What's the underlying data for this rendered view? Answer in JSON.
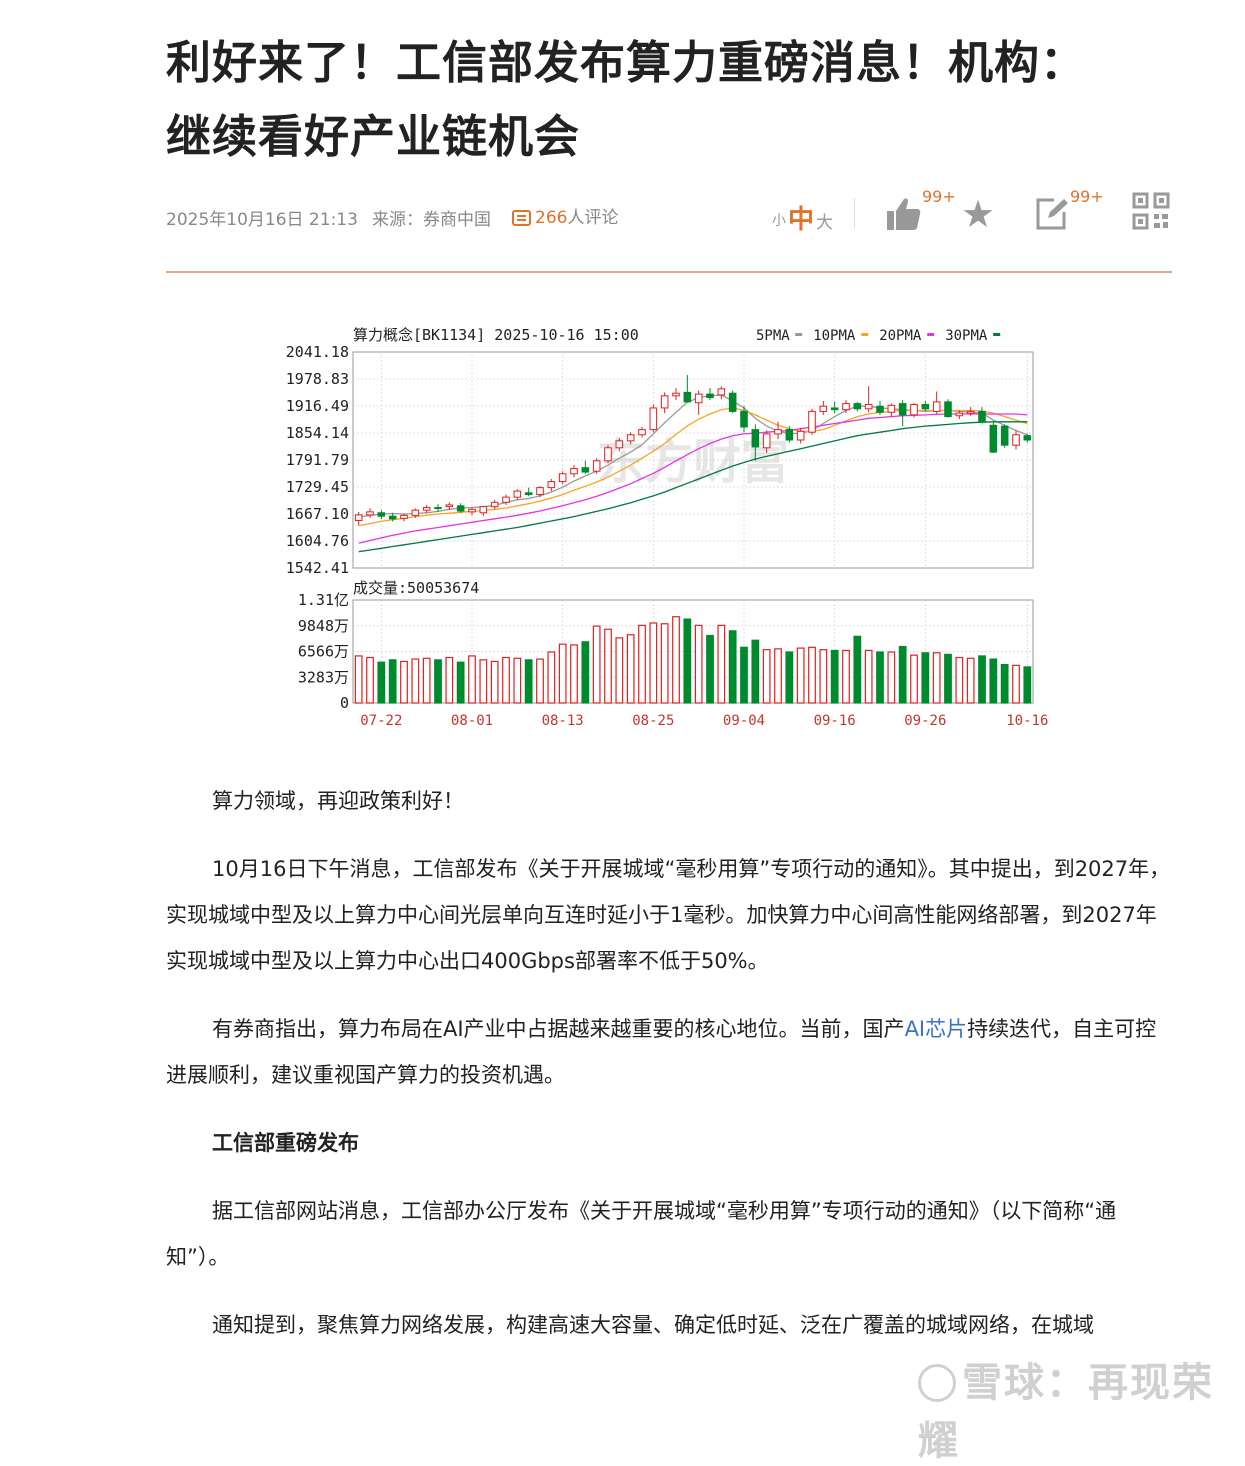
{
  "article": {
    "title_line1": "利好来了！工信部发布算力重磅消息！机构：",
    "title_line2": "继续看好产业链机会",
    "date": "2025年10月16日 21:13",
    "source": "来源：券商中国",
    "comments_count": "266",
    "comments_label": "人评论",
    "font_small": "小",
    "font_mid": "中",
    "font_big": "大",
    "like_count": "99+",
    "edit_count": "99+",
    "paragraphs": [
      {
        "type": "p",
        "text": "算力领域，再迎政策利好！"
      },
      {
        "type": "p",
        "text": "10月16日下午消息，工信部发布《关于开展城域“毫秒用算”专项行动的通知》。其中提出，到2027年，实现城域中型及以上算力中心间光层单向互连时延小于1毫秒。加快算力中心间高性能网络部署，到2027年实现城域中型及以上算力中心出口400Gbps部署率不低于50%。"
      },
      {
        "type": "p_link",
        "before": "有券商指出，算力布局在AI产业中占据越来越重要的核心地位。当前，国产",
        "link": "AI芯片",
        "after": "持续迭代，自主可控进展顺利，建议重视国产算力的投资机遇。"
      },
      {
        "type": "h",
        "text": "工信部重磅发布"
      },
      {
        "type": "p",
        "text": "据工信部网站消息，工信部办公厅发布《关于开展城域“毫秒用算”专项行动的通知》（以下简称“通知”）。"
      },
      {
        "type": "p",
        "text": "通知提到，聚焦算力网络发展，构建高速大容量、确定低时延、泛在广覆盖的城域网络，在城域"
      }
    ],
    "watermark": "雪球：再现荣耀"
  },
  "chart_data": {
    "type": "candlestick",
    "title": "算力概念[BK1134] 2025-10-16 15:00",
    "legend": [
      {
        "name": "5PMA",
        "color": "#999999"
      },
      {
        "name": "10PMA",
        "color": "#f5a623"
      },
      {
        "name": "20PMA",
        "color": "#e633e6"
      },
      {
        "name": "30PMA",
        "color": "#007a3d"
      }
    ],
    "price_ticks": [
      "2041.18",
      "1978.83",
      "1916.49",
      "1854.14",
      "1791.79",
      "1729.45",
      "1667.10",
      "1604.76",
      "1542.41"
    ],
    "ylim": [
      1542.41,
      2041.18
    ],
    "volume_label": "成交量:50053674",
    "volume_ticks": [
      "1.31亿",
      "9848万",
      "6566万",
      "3283万",
      "0"
    ],
    "volume_max": 131300000,
    "x_tick_labels": [
      "07-22",
      "08-01",
      "08-13",
      "08-25",
      "09-04",
      "09-16",
      "09-26",
      "10-16"
    ],
    "x_tick_index": [
      2,
      10,
      18,
      26,
      34,
      42,
      50,
      59
    ],
    "watermark": "东方财富",
    "candles": [
      {
        "o": 1652,
        "h": 1672,
        "l": 1641,
        "c": 1665
      },
      {
        "o": 1665,
        "h": 1680,
        "l": 1658,
        "c": 1672
      },
      {
        "o": 1670,
        "h": 1676,
        "l": 1655,
        "c": 1662
      },
      {
        "o": 1662,
        "h": 1670,
        "l": 1650,
        "c": 1656
      },
      {
        "o": 1657,
        "h": 1668,
        "l": 1650,
        "c": 1664
      },
      {
        "o": 1664,
        "h": 1680,
        "l": 1658,
        "c": 1676
      },
      {
        "o": 1676,
        "h": 1688,
        "l": 1670,
        "c": 1682
      },
      {
        "o": 1682,
        "h": 1690,
        "l": 1672,
        "c": 1680
      },
      {
        "o": 1684,
        "h": 1694,
        "l": 1676,
        "c": 1688
      },
      {
        "o": 1686,
        "h": 1692,
        "l": 1670,
        "c": 1674
      },
      {
        "o": 1672,
        "h": 1682,
        "l": 1664,
        "c": 1678
      },
      {
        "o": 1670,
        "h": 1686,
        "l": 1662,
        "c": 1684
      },
      {
        "o": 1684,
        "h": 1700,
        "l": 1678,
        "c": 1694
      },
      {
        "o": 1694,
        "h": 1712,
        "l": 1688,
        "c": 1706
      },
      {
        "o": 1706,
        "h": 1724,
        "l": 1700,
        "c": 1720
      },
      {
        "o": 1716,
        "h": 1728,
        "l": 1708,
        "c": 1712
      },
      {
        "o": 1712,
        "h": 1732,
        "l": 1706,
        "c": 1728
      },
      {
        "o": 1728,
        "h": 1748,
        "l": 1720,
        "c": 1742
      },
      {
        "o": 1742,
        "h": 1766,
        "l": 1736,
        "c": 1760
      },
      {
        "o": 1760,
        "h": 1780,
        "l": 1752,
        "c": 1772
      },
      {
        "o": 1774,
        "h": 1790,
        "l": 1760,
        "c": 1764
      },
      {
        "o": 1766,
        "h": 1796,
        "l": 1760,
        "c": 1790
      },
      {
        "o": 1790,
        "h": 1826,
        "l": 1784,
        "c": 1820
      },
      {
        "o": 1820,
        "h": 1842,
        "l": 1812,
        "c": 1836
      },
      {
        "o": 1836,
        "h": 1856,
        "l": 1828,
        "c": 1850
      },
      {
        "o": 1850,
        "h": 1868,
        "l": 1844,
        "c": 1862
      },
      {
        "o": 1862,
        "h": 1920,
        "l": 1856,
        "c": 1912
      },
      {
        "o": 1912,
        "h": 1948,
        "l": 1900,
        "c": 1940
      },
      {
        "o": 1940,
        "h": 1958,
        "l": 1930,
        "c": 1946
      },
      {
        "o": 1948,
        "h": 1988,
        "l": 1938,
        "c": 1926
      },
      {
        "o": 1924,
        "h": 1952,
        "l": 1896,
        "c": 1944
      },
      {
        "o": 1944,
        "h": 1958,
        "l": 1930,
        "c": 1936
      },
      {
        "o": 1942,
        "h": 1962,
        "l": 1932,
        "c": 1956
      },
      {
        "o": 1946,
        "h": 1952,
        "l": 1900,
        "c": 1904
      },
      {
        "o": 1904,
        "h": 1916,
        "l": 1856,
        "c": 1868
      },
      {
        "o": 1862,
        "h": 1874,
        "l": 1790,
        "c": 1822
      },
      {
        "o": 1820,
        "h": 1860,
        "l": 1808,
        "c": 1852
      },
      {
        "o": 1852,
        "h": 1880,
        "l": 1840,
        "c": 1862
      },
      {
        "o": 1862,
        "h": 1870,
        "l": 1832,
        "c": 1838
      },
      {
        "o": 1838,
        "h": 1866,
        "l": 1830,
        "c": 1858
      },
      {
        "o": 1856,
        "h": 1910,
        "l": 1850,
        "c": 1904
      },
      {
        "o": 1904,
        "h": 1928,
        "l": 1896,
        "c": 1916
      },
      {
        "o": 1912,
        "h": 1926,
        "l": 1900,
        "c": 1908
      },
      {
        "o": 1908,
        "h": 1930,
        "l": 1900,
        "c": 1922
      },
      {
        "o": 1922,
        "h": 1926,
        "l": 1904,
        "c": 1910
      },
      {
        "o": 1910,
        "h": 1962,
        "l": 1902,
        "c": 1920
      },
      {
        "o": 1916,
        "h": 1928,
        "l": 1896,
        "c": 1902
      },
      {
        "o": 1902,
        "h": 1922,
        "l": 1892,
        "c": 1918
      },
      {
        "o": 1922,
        "h": 1930,
        "l": 1870,
        "c": 1896
      },
      {
        "o": 1896,
        "h": 1924,
        "l": 1890,
        "c": 1920
      },
      {
        "o": 1920,
        "h": 1928,
        "l": 1904,
        "c": 1910
      },
      {
        "o": 1904,
        "h": 1950,
        "l": 1898,
        "c": 1926
      },
      {
        "o": 1926,
        "h": 1932,
        "l": 1890,
        "c": 1892
      },
      {
        "o": 1894,
        "h": 1906,
        "l": 1886,
        "c": 1900
      },
      {
        "o": 1900,
        "h": 1914,
        "l": 1894,
        "c": 1904
      },
      {
        "o": 1904,
        "h": 1914,
        "l": 1876,
        "c": 1880
      },
      {
        "o": 1872,
        "h": 1880,
        "l": 1808,
        "c": 1810
      },
      {
        "o": 1870,
        "h": 1874,
        "l": 1820,
        "c": 1826
      },
      {
        "o": 1826,
        "h": 1860,
        "l": 1816,
        "c": 1850
      },
      {
        "o": 1848,
        "h": 1852,
        "l": 1832,
        "c": 1838
      }
    ],
    "volumes": [
      60,
      58,
      52,
      55,
      53,
      56,
      57,
      55,
      58,
      52,
      60,
      55,
      53,
      58,
      57,
      55,
      56,
      65,
      75,
      74,
      78,
      98,
      94,
      83,
      87,
      99,
      102,
      101,
      110,
      107,
      99,
      86,
      99,
      92,
      71,
      80,
      68,
      69,
      65,
      70,
      71,
      68,
      67,
      67,
      85,
      67,
      65,
      65,
      72,
      61,
      64,
      64,
      62,
      58,
      57,
      60,
      56,
      49,
      48,
      46
    ],
    "ma5": [
      1660,
      1664,
      1667,
      1668,
      1667,
      1668,
      1670,
      1673,
      1678,
      1681,
      1682,
      1684,
      1687,
      1694,
      1700,
      1703,
      1709,
      1718,
      1729,
      1743,
      1755,
      1766,
      1780,
      1796,
      1810,
      1827,
      1852,
      1878,
      1902,
      1925,
      1936,
      1940,
      1942,
      1928,
      1912,
      1888,
      1870,
      1858,
      1852,
      1854,
      1860,
      1876,
      1892,
      1906,
      1916,
      1916,
      1912,
      1910,
      1908,
      1906,
      1904,
      1906,
      1906,
      1904,
      1902,
      1900,
      1884,
      1872,
      1860,
      1850
    ],
    "ma10": [
      1640,
      1645,
      1650,
      1654,
      1657,
      1661,
      1664,
      1667,
      1669,
      1671,
      1673,
      1675,
      1678,
      1681,
      1686,
      1691,
      1697,
      1704,
      1712,
      1722,
      1731,
      1741,
      1752,
      1766,
      1780,
      1796,
      1812,
      1830,
      1851,
      1870,
      1886,
      1898,
      1908,
      1912,
      1906,
      1896,
      1884,
      1872,
      1864,
      1858,
      1858,
      1862,
      1872,
      1882,
      1892,
      1898,
      1902,
      1904,
      1906,
      1906,
      1906,
      1906,
      1906,
      1906,
      1906,
      1905,
      1900,
      1892,
      1884,
      1876
    ],
    "ma20": [
      1600,
      1606,
      1612,
      1618,
      1623,
      1628,
      1632,
      1636,
      1640,
      1644,
      1648,
      1652,
      1656,
      1660,
      1664,
      1669,
      1674,
      1680,
      1686,
      1693,
      1700,
      1708,
      1717,
      1727,
      1737,
      1749,
      1761,
      1775,
      1790,
      1804,
      1818,
      1830,
      1840,
      1848,
      1852,
      1854,
      1856,
      1858,
      1860,
      1864,
      1868,
      1872,
      1876,
      1880,
      1884,
      1888,
      1890,
      1892,
      1894,
      1895,
      1896,
      1897,
      1898,
      1898,
      1898,
      1898,
      1898,
      1898,
      1898,
      1896
    ],
    "ma30": [
      1580,
      1584,
      1588,
      1592,
      1596,
      1600,
      1604,
      1608,
      1612,
      1616,
      1620,
      1624,
      1628,
      1632,
      1636,
      1641,
      1646,
      1651,
      1656,
      1661,
      1667,
      1673,
      1679,
      1686,
      1693,
      1701,
      1709,
      1718,
      1728,
      1738,
      1748,
      1758,
      1768,
      1778,
      1786,
      1794,
      1800,
      1806,
      1812,
      1818,
      1824,
      1830,
      1836,
      1842,
      1848,
      1852,
      1856,
      1860,
      1864,
      1867,
      1870,
      1872,
      1874,
      1876,
      1878,
      1879,
      1880,
      1880,
      1880,
      1880
    ]
  }
}
